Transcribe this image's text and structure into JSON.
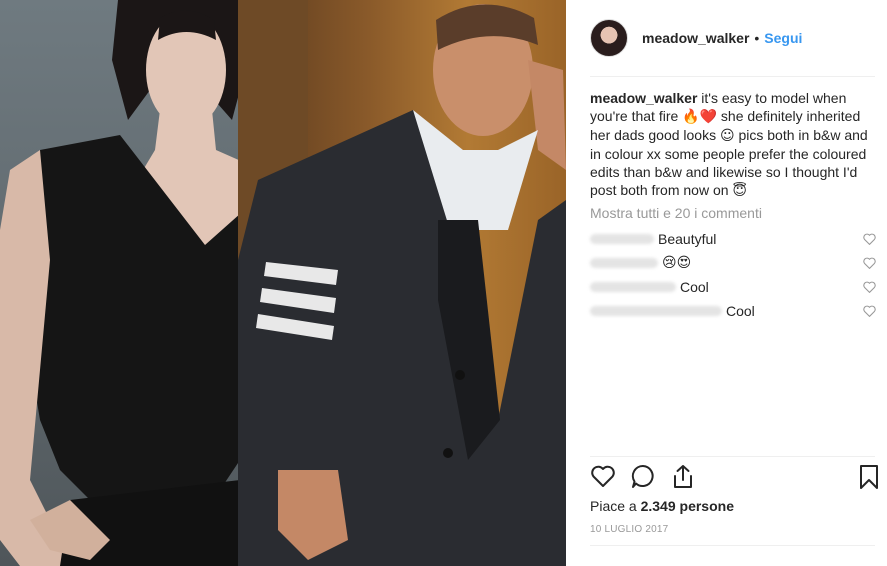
{
  "header": {
    "username": "meadow_walker",
    "separator": "•",
    "follow_label": "Segui"
  },
  "caption": {
    "username": "meadow_walker",
    "text_1": " it's easy to model when you're that fire ",
    "emoji_1": "🔥❤️",
    "text_2": " she definitely inherited her dads good looks ",
    "emoji_2": "☺",
    "text_3": " pics both in b&w and in colour xx some people prefer the coloured edits than b&w and likewise so I thought I'd post both from now on ",
    "emoji_3": "😇"
  },
  "view_all_comments": "Mostra tutti e 20 i commenti",
  "comments": [
    {
      "text": "Beautyful"
    },
    {
      "text": "😢😍"
    },
    {
      "text": "Cool"
    },
    {
      "text": "Cool"
    }
  ],
  "likes": {
    "prefix": "Piace a ",
    "count": "2.349 persone"
  },
  "date": "10 LUGLIO 2017",
  "colors": {
    "accent": "#3897f0",
    "text": "#262626",
    "muted": "#999999",
    "divider": "#efefef"
  },
  "icons": [
    "heart-icon",
    "comment-icon",
    "share-icon",
    "bookmark-icon"
  ]
}
